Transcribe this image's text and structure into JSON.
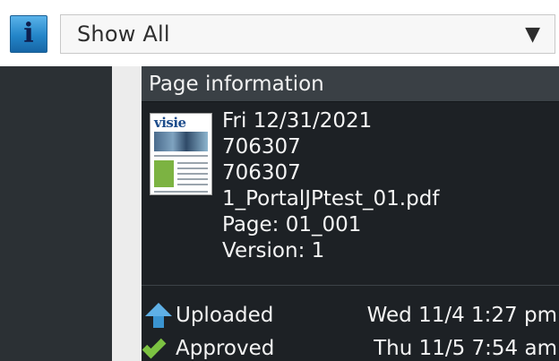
{
  "toolbar": {
    "info_icon_glyph": "i",
    "filter": {
      "selected": "Show All",
      "arrow_glyph": "▼"
    }
  },
  "panel": {
    "title": "Page information",
    "thumbnail_logo": "visie",
    "date": "Fri 12/31/2021",
    "id_1": "706307",
    "id_2": "706307",
    "filename": "1_PortalJPtest_01.pdf",
    "page": "Page: 01_001",
    "version": "Version: 1",
    "events": [
      {
        "icon": "arrow-up-icon",
        "label": "Uploaded",
        "time": "Wed 11/4 1:27 pm"
      },
      {
        "icon": "check-icon",
        "label": "Approved",
        "time": "Thu 11/5 7:54 am"
      }
    ]
  },
  "colors": {
    "info_button": "#2385c8",
    "panel_bg": "#1d2125",
    "panel_header_bg": "#3a4045",
    "left_pane_bg": "#2b3034",
    "upload_arrow": "#5fb0e6",
    "approve_check": "#7cc242"
  }
}
